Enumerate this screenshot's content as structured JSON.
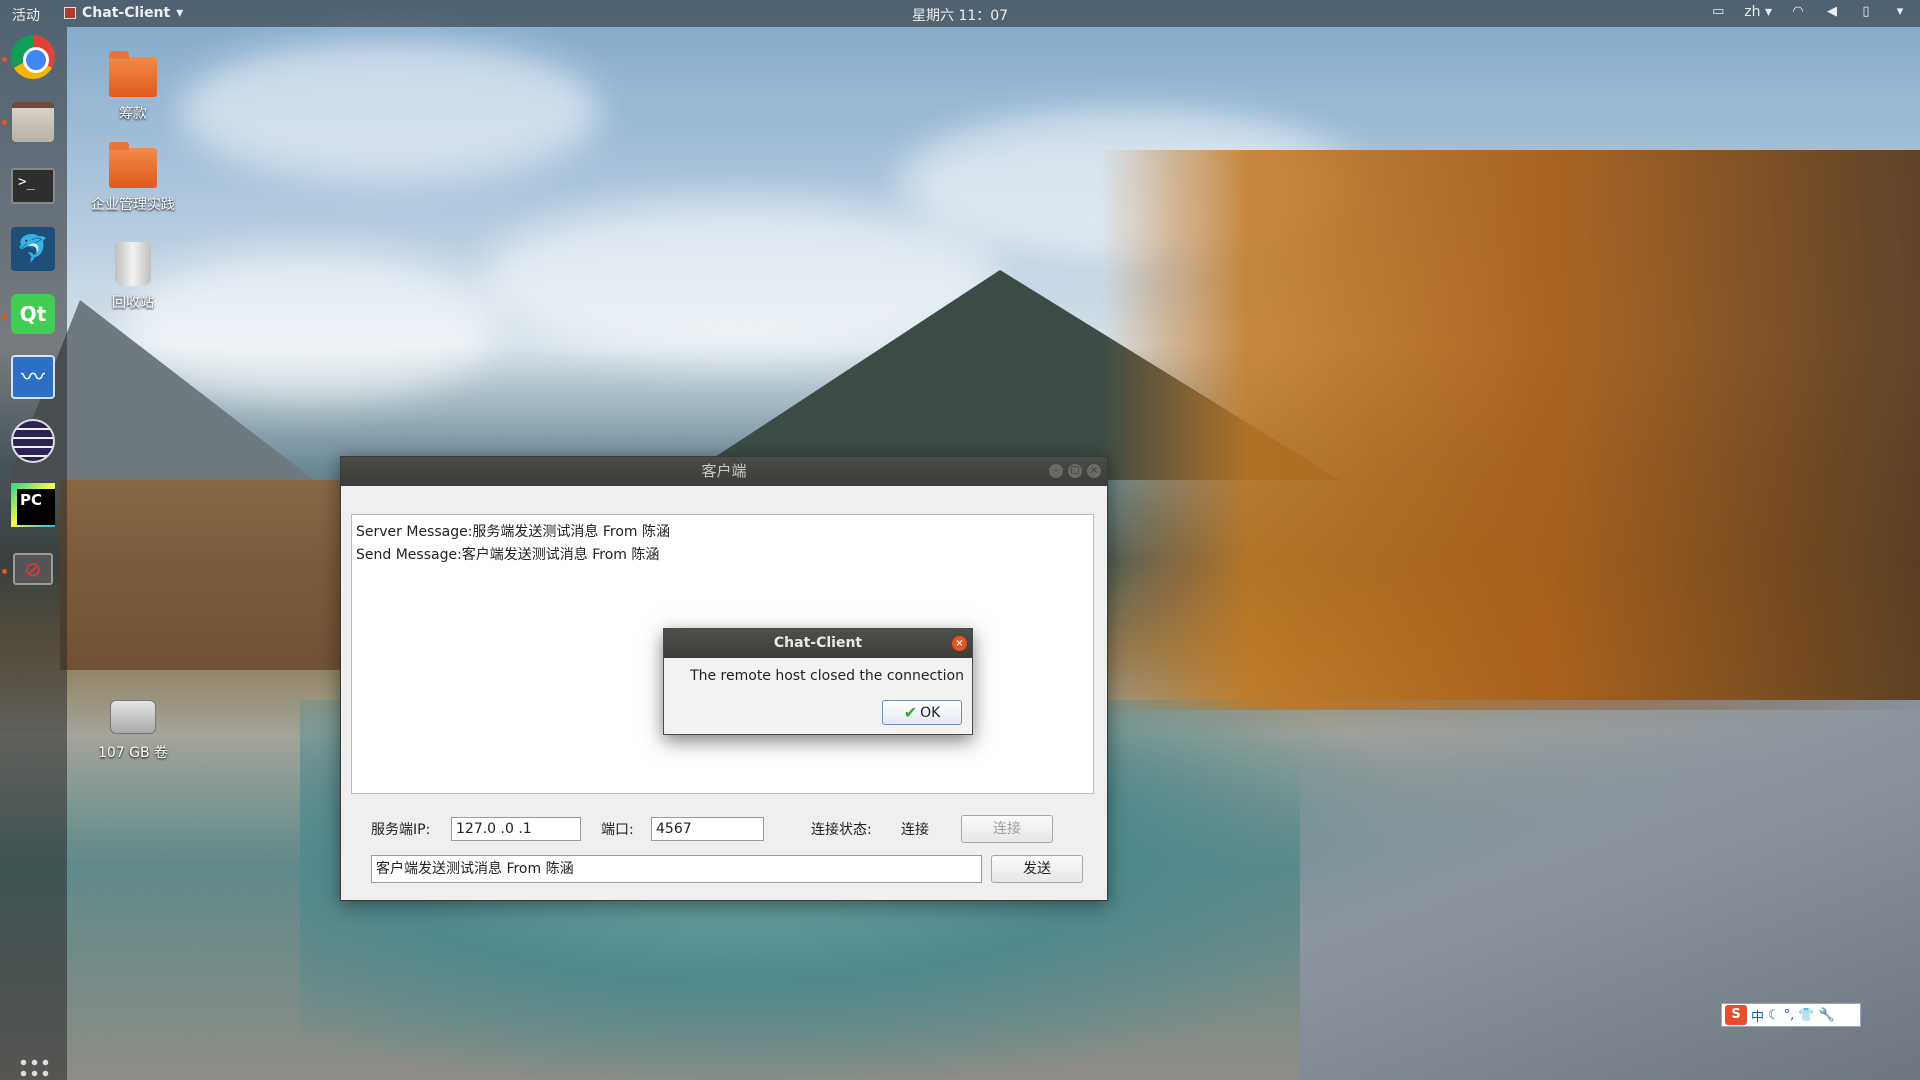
{
  "top_panel": {
    "activities": "活动",
    "app_menu": "Chat-Client",
    "clock": "星期六 11：07",
    "lang": "zh"
  },
  "desktop_icons": [
    {
      "label": "筹款"
    },
    {
      "label": "企业管理实践"
    },
    {
      "label": "回收站"
    },
    {
      "label": "107 GB 卷"
    }
  ],
  "dock": {
    "items": [
      "chrome-icon",
      "files-icon",
      "terminal-icon",
      "mysql-workbench-icon",
      "qt-creator-icon",
      "system-monitor-icon",
      "eclipse-icon",
      "pycharm-icon",
      "blocked-app-icon"
    ]
  },
  "window": {
    "title": "客户端",
    "messages": [
      "Server Message:服务端发送测试消息 From 陈涵",
      "Send Message:客户端发送测试消息 From 陈涵"
    ],
    "server_ip_label": "服务端IP:",
    "server_ip_value": "127.0 .0 .1",
    "port_label": "端口:",
    "port_value": "4567",
    "status_label": "连接状态:",
    "status_value": "连接",
    "connect_button": "连接",
    "message_input": "客户端发送测试消息 From 陈涵",
    "send_button": "发送"
  },
  "dialog": {
    "title": "Chat-Client",
    "message": "The remote host closed the connection",
    "ok_button": "OK"
  },
  "ime": {
    "label": "中"
  }
}
